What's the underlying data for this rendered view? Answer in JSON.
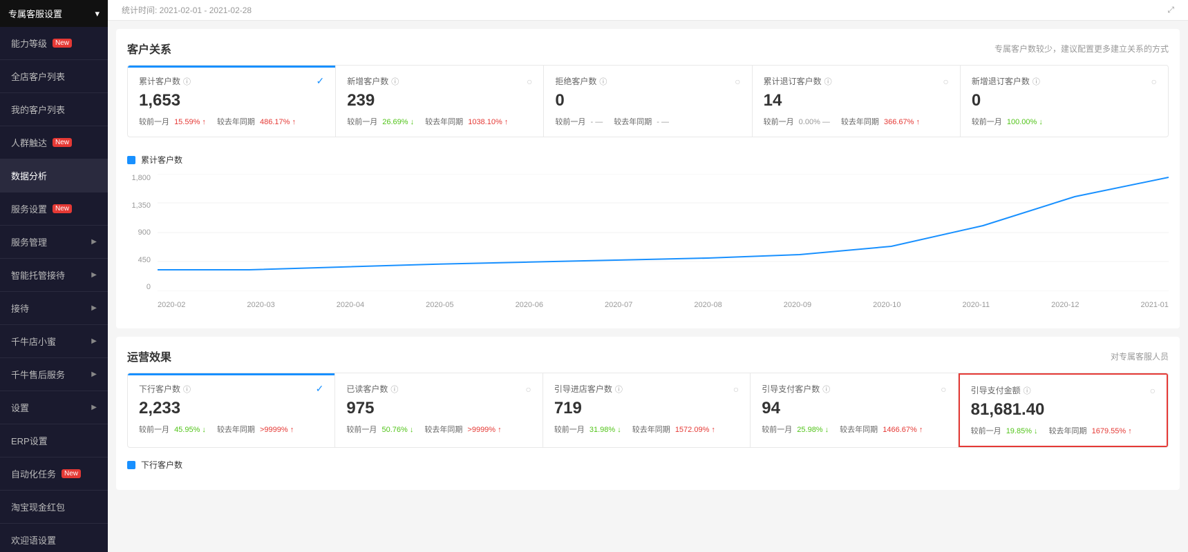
{
  "sidebar": {
    "header": "专属客服设置",
    "items": [
      {
        "id": "ability",
        "label": "能力等级",
        "badge": "New",
        "arrow": false
      },
      {
        "id": "all-customers",
        "label": "全店客户列表",
        "badge": null,
        "arrow": false
      },
      {
        "id": "my-customers",
        "label": "我的客户列表",
        "badge": null,
        "arrow": false
      },
      {
        "id": "reach",
        "label": "人群触达",
        "badge": "New",
        "arrow": false
      },
      {
        "id": "data-analysis",
        "label": "数据分析",
        "badge": null,
        "arrow": false,
        "active": true
      },
      {
        "id": "service-settings",
        "label": "服务设置",
        "badge": "New",
        "arrow": false
      },
      {
        "id": "service-mgmt",
        "label": "服务管理",
        "badge": null,
        "arrow": true
      },
      {
        "id": "smart-host",
        "label": "智能托管接待",
        "badge": null,
        "arrow": true
      },
      {
        "id": "reception",
        "label": "接待",
        "badge": null,
        "arrow": true
      },
      {
        "id": "qianniu-bee",
        "label": "千牛店小蜜",
        "badge": null,
        "arrow": true
      },
      {
        "id": "after-sales",
        "label": "千牛售后服务",
        "badge": null,
        "arrow": true
      },
      {
        "id": "settings",
        "label": "设置",
        "badge": null,
        "arrow": true
      },
      {
        "id": "erp",
        "label": "ERP设置",
        "badge": null,
        "arrow": false
      },
      {
        "id": "auto-tasks",
        "label": "自动化任务",
        "badge": "New",
        "arrow": false
      },
      {
        "id": "hongbao",
        "label": "淘宝现金红包",
        "badge": null,
        "arrow": false
      },
      {
        "id": "welcome",
        "label": "欢迎语设置",
        "badge": null,
        "arrow": false
      }
    ]
  },
  "topbar": {
    "date_range": "统计时间: 2021-02-01 - 2021-02-28"
  },
  "customer_relation": {
    "title": "客户关系",
    "hint": "专属客户数较少，建议配置更多建立关系的方式",
    "stats": [
      {
        "id": "cumulative",
        "label": "累计客户数",
        "value": "1,653",
        "selected": true,
        "compare_month": "15.59%",
        "compare_month_dir": "up",
        "compare_year": "486.17%",
        "compare_year_dir": "up"
      },
      {
        "id": "new",
        "label": "新增客户数",
        "value": "239",
        "selected": false,
        "compare_month": "26.69%",
        "compare_month_dir": "down",
        "compare_year": "1038.10%",
        "compare_year_dir": "up"
      },
      {
        "id": "rejected",
        "label": "拒绝客户数",
        "value": "0",
        "selected": false,
        "compare_month": "-",
        "compare_month_dir": "neutral",
        "compare_year": "-",
        "compare_year_dir": "neutral"
      },
      {
        "id": "cumulative-unsub",
        "label": "累计退订客户数",
        "value": "14",
        "selected": false,
        "compare_month": "0.00%",
        "compare_month_dir": "neutral",
        "compare_year": "366.67%",
        "compare_year_dir": "up"
      },
      {
        "id": "new-unsub",
        "label": "新增退订客户数",
        "value": "0",
        "selected": false,
        "compare_month": "100.00%",
        "compare_month_dir": "down",
        "compare_year": "",
        "compare_year_dir": "neutral"
      }
    ],
    "chart": {
      "legend": "累计客户数",
      "y_labels": [
        "1,800",
        "1,350",
        "900",
        "450",
        "0"
      ],
      "x_labels": [
        "2020-02",
        "2020-03",
        "2020-04",
        "2020-05",
        "2020-06",
        "2020-07",
        "2020-08",
        "2020-09",
        "2020-10",
        "2020-11",
        "2020-12",
        "2021-01"
      ]
    }
  },
  "operation_effect": {
    "title": "运营效果",
    "hint": "对专属客服人员",
    "stats": [
      {
        "id": "sent-customers",
        "label": "下行客户数",
        "value": "2,233",
        "selected": true,
        "compare_month": "45.95%",
        "compare_month_dir": "down",
        "compare_year": ">9999%",
        "compare_year_dir": "up"
      },
      {
        "id": "read-customers",
        "label": "已读客户数",
        "value": "975",
        "selected": false,
        "compare_month": "50.76%",
        "compare_month_dir": "down",
        "compare_year": ">9999%",
        "compare_year_dir": "up"
      },
      {
        "id": "guided-enter",
        "label": "引导进店客户数",
        "value": "719",
        "selected": false,
        "compare_month": "31.98%",
        "compare_month_dir": "down",
        "compare_year": "1572.09%",
        "compare_year_dir": "up"
      },
      {
        "id": "guided-pay-customers",
        "label": "引导支付客户数",
        "value": "94",
        "selected": false,
        "compare_month": "25.98%",
        "compare_month_dir": "down",
        "compare_year": "1466.67%",
        "compare_year_dir": "up"
      },
      {
        "id": "guided-pay-amount",
        "label": "引导支付金额",
        "value": "81,681.40",
        "selected": false,
        "highlighted": true,
        "compare_month": "19.85%",
        "compare_month_dir": "down",
        "compare_year": "1679.55%",
        "compare_year_dir": "up"
      }
    ],
    "chart_legend": "下行客户数"
  },
  "labels": {
    "compare_month": "较前一月",
    "compare_year": "较去年同期"
  }
}
